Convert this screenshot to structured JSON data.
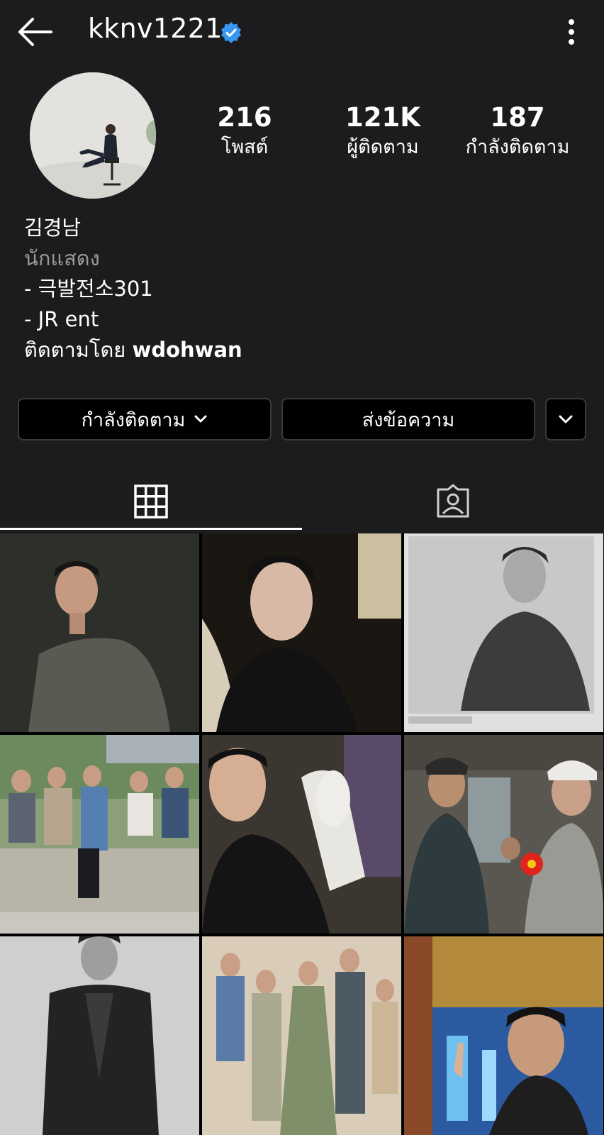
{
  "header": {
    "username": "kknv1221",
    "back_icon": "arrow-left-icon",
    "verified_icon": "verified-badge-icon",
    "menu_icon": "kebab-menu-icon"
  },
  "stats": {
    "posts": {
      "value": "216",
      "label": "โพสต์"
    },
    "followers": {
      "value": "121K",
      "label": "ผู้ติดตาม"
    },
    "following": {
      "value": "187",
      "label": "กำลังติดตาม"
    }
  },
  "bio": {
    "name": "김경남",
    "category": "นักแสดง",
    "line1": "- 극발전소301",
    "line2": "- JR ent",
    "followed_by_prefix": "ติดตามโดย",
    "followed_by_user": "wdohwan"
  },
  "actions": {
    "following_label": "กำลังติดตาม",
    "message_label": "ส่งข้อความ"
  },
  "tabs": [
    {
      "icon": "grid-icon",
      "active": true
    },
    {
      "icon": "tagged-person-icon",
      "active": false
    }
  ],
  "colors": {
    "background": "#1c1c1e",
    "verified": "#3897f0",
    "button_border": "#3a3a3c"
  }
}
